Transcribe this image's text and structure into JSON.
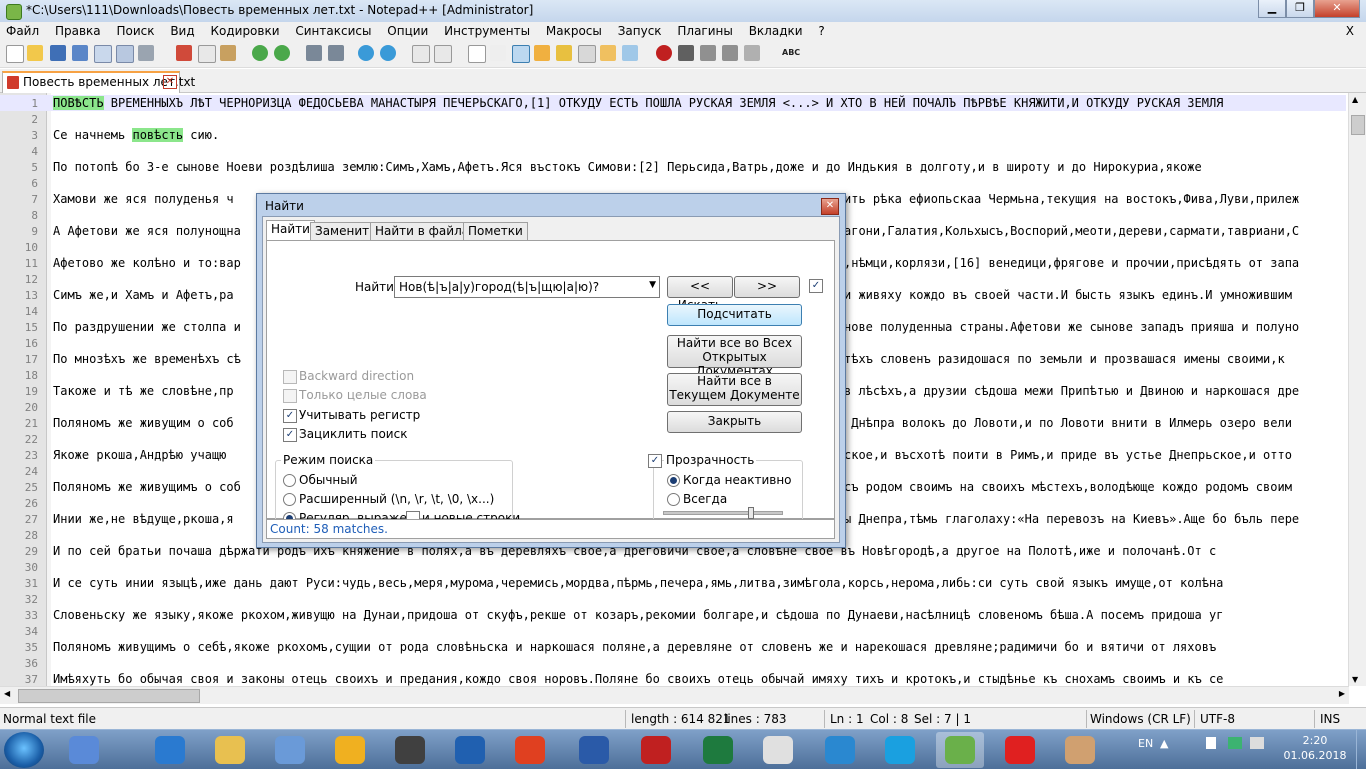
{
  "window": {
    "title": "*C:\\Users\\111\\Downloads\\Повесть временных лет.txt - Notepad++ [Administrator]",
    "minimize": "▁",
    "maximize": "❐",
    "close": "✕"
  },
  "menu": [
    "Файл",
    "Правка",
    "Поиск",
    "Вид",
    "Кодировки",
    "Синтаксисы",
    "Опции",
    "Инструменты",
    "Макросы",
    "Запуск",
    "Плагины",
    "Вкладки",
    "?"
  ],
  "menu_close": "X",
  "toolbar": {
    "icons": [
      "new-file-icon",
      "open-file-icon",
      "save-icon",
      "save-all-icon",
      "close-icon",
      "close-all-icon",
      "print-icon",
      "cut-icon",
      "copy-icon",
      "paste-icon",
      "undo-icon",
      "redo-icon",
      "find-icon",
      "replace-icon",
      "zoom-in-icon",
      "zoom-out-icon",
      "sync-vertical-icon",
      "sync-horizontal-icon",
      "word-wrap-icon",
      "show-all-chars-icon",
      "indent-guide-icon",
      "udl-icon",
      "doc-map-icon",
      "function-list-icon",
      "folder-workspace-icon",
      "monitoring-icon",
      "record-macro-icon",
      "stop-record-icon",
      "play-macro-icon",
      "play-multiple-icon",
      "save-macro-icon",
      "spell-check-icon"
    ],
    "spell_label": "ABC"
  },
  "tab": {
    "label": "Повесть временных лет.txt",
    "close": "✕"
  },
  "editor": {
    "lines": [
      {
        "n": "1",
        "pre": "",
        "hl": "ПОВѢСТЬ",
        "post": " ВРЕМЕННЫХЪ ЛѢТ ЧЕРНОРИЗЦА ФЕДОСЬЕВА МАНАСТЫРЯ ПЕЧЕРЬСКАГО,[1] ОТКУДУ ЕСТЬ ПОШЛА РУСКАЯ ЗЕМЛЯ <...> И ХТО В НЕЙ ПОЧАЛЪ ПѢРВѢЕ КНЯЖИТИ,И ОТКУДУ РУСКАЯ ЗЕМЛЯ"
      },
      {
        "n": "2",
        "pre": "",
        "hl": "",
        "post": ""
      },
      {
        "n": "3",
        "pre": "Се начнемь ",
        "hl": "повѣсть",
        "post": " сию."
      },
      {
        "n": "4",
        "pre": "",
        "hl": "",
        "post": ""
      },
      {
        "n": "5",
        "pre": "По потопѣ бо 3-е сынове Ноеви роздѣлиша землю:Симъ,Хамъ,Афетъ.Яся въстокъ Симови:[2] Перьсида,Ватрь,доже и до Индькия в долготу,и в широту и до Нирокуриа,якоже",
        "hl": "",
        "post": ""
      },
      {
        "n": "6",
        "pre": "",
        "hl": "",
        "post": ""
      },
      {
        "n": "7",
        "pre": "Хамови же яся полуденья ч",
        "hl": "",
        "post": ""
      },
      {
        "n": "8",
        "pre": "",
        "hl": "",
        "post": ""
      },
      {
        "n": "9",
        "pre": "А Афетови же яся полунощна",
        "hl": "",
        "post": ""
      },
      {
        "n": "10",
        "pre": "",
        "hl": "",
        "post": ""
      },
      {
        "n": "11",
        "pre": "Афетово же колѣно и то:вар",
        "hl": "",
        "post": ""
      },
      {
        "n": "12",
        "pre": "",
        "hl": "",
        "post": ""
      },
      {
        "n": "13",
        "pre": "Симъ же,и Хамъ и Афетъ,ра",
        "hl": "",
        "post": ""
      },
      {
        "n": "14",
        "pre": "",
        "hl": "",
        "post": ""
      },
      {
        "n": "15",
        "pre": "По раздрушении же столпа и",
        "hl": "",
        "post": ""
      },
      {
        "n": "16",
        "pre": "",
        "hl": "",
        "post": ""
      },
      {
        "n": "17",
        "pre": "По мнозѣхъ же временѣхъ сѣ",
        "hl": "",
        "post": ""
      },
      {
        "n": "18",
        "pre": "",
        "hl": "",
        "post": ""
      },
      {
        "n": "19",
        "pre": "Такоже и тѣ же словѣне,пр",
        "hl": "",
        "post": ""
      },
      {
        "n": "20",
        "pre": "",
        "hl": "",
        "post": ""
      },
      {
        "n": "21",
        "pre": "Поляномъ же живущим о соб",
        "hl": "",
        "post": ""
      },
      {
        "n": "22",
        "pre": "",
        "hl": "",
        "post": ""
      },
      {
        "n": "23",
        "pre": "Якоже ркоша,Андрѣю учащю",
        "hl": "",
        "post": ""
      },
      {
        "n": "24",
        "pre": "",
        "hl": "",
        "post": ""
      },
      {
        "n": "25",
        "pre": "Поляномъ же живущимъ о соб",
        "hl": "",
        "post": ""
      },
      {
        "n": "26",
        "pre": "",
        "hl": "",
        "post": ""
      },
      {
        "n": "27",
        "pre": "Инии же,не вѣдуще,ркоша,я",
        "hl": "",
        "post": ""
      },
      {
        "n": "28",
        "pre": "",
        "hl": "",
        "post": ""
      },
      {
        "n": "29",
        "pre": "И по сей братьи почаша дѣржати родъ ихъ княжение в полях,а въ деревляхъ свое,а дреговичи свое,а словѣне свое въ Новѣгородѣ,а другое на Полотѣ,иже и полочанѣ.От с",
        "hl": "",
        "post": ""
      },
      {
        "n": "30",
        "pre": "",
        "hl": "",
        "post": ""
      },
      {
        "n": "31",
        "pre": "И се суть инии языцѣ,иже дань дают Руси:чудь,весь,меря,мурома,черемись,мордва,пѣрмь,печера,ямь,литва,зимѣгола,корсь,нерома,либь:си суть свой языкъ имуще,от колѣна",
        "hl": "",
        "post": ""
      },
      {
        "n": "32",
        "pre": "",
        "hl": "",
        "post": ""
      },
      {
        "n": "33",
        "pre": "Словеньску же языку,якоже ркохом,живущю на Дунаи,придоша от скуфъ,рекше от козаръ,рекомии болгаре,и сѣдоша по Дунаеви,насѣлницѣ словеномъ бѣша.А посемъ придоша уг",
        "hl": "",
        "post": ""
      },
      {
        "n": "34",
        "pre": "",
        "hl": "",
        "post": ""
      },
      {
        "n": "35",
        "pre": "Поляномъ живущимъ о себѣ,якоже ркохомъ,сущии от рода словѣньска и наркошася поляне,а деревляне от словенъ же и нарекошася древляне;радимичи бо и вятичи от ляховъ",
        "hl": "",
        "post": ""
      },
      {
        "n": "36",
        "pre": "",
        "hl": "",
        "post": ""
      },
      {
        "n": "37",
        "pre": "Имѣяхуть бо обычая своя и законы отець своихъ и предания,кождо своя норовъ.Поляне бо своихъ отець обычай имяху тихъ и кротокъ,и стыдѣнье къ снохамъ своимъ и къ се",
        "hl": "",
        "post": ""
      }
    ],
    "right_text": {
      "7": "ить рѣка ефиопьскаа Чермьна,текущия на востокъ,Фива,Луви,прилеж",
      "9": "агони,Галатия,Кольхысъ,Воспорий,меоти,дереви,сармати,тавриани,С",
      "11": ",нѣмци,корлязи,[16] венедици,фрягове и прочии,присѣдять от запа",
      "13": "и живяху кождо въ своей части.И бысть языкъ единъ.И умножившим",
      "15": "нове полуденныа страны.Афетови же сынове западъ прияша и полуно",
      "17": "тѣхъ словенъ разидошася по земьли и прозвашася имены своими,к",
      "19": "в лѣсѣхъ,а друзии сѣдоша межи Припѣтью и Двиною и наркошася дре",
      "21": " Днѣпра волокъ до Ловоти,и по Ловоти внити в Илмерь озеро вели",
      "23": "ское,и въсхотѣ поити в Римъ,и приде въ устье Днепрьское,и отто",
      "25": "съ родом своимъ на своихъ мѣстехъ,володѣюще кождо родомъ своим",
      "27": "ы Днепра,тѣмь глаголаху:«На перевозъ на Киевъ».Аще бо бъль пере"
    }
  },
  "find_dialog": {
    "title": "Найти",
    "tabs": [
      "Найти",
      "Заменить",
      "Найти в файлах",
      "Пометки"
    ],
    "find_label": "Найти:",
    "find_value": "Нов(ѣ|ъ|а|у)город(ѣ|ъ|щю|а|ю)?",
    "buttons": {
      "prev": "<< Искать",
      "next": ">>",
      "count": "Подсчитать",
      "find_all_open_1": "Найти все во Всех",
      "find_all_open_2": "Открытых Документах",
      "find_all_current_1": "Найти все в",
      "find_all_current_2": "Текущем Документе",
      "close": "Закрыть"
    },
    "options": {
      "backward": {
        "label": "Backward direction",
        "checked": false,
        "enabled": false
      },
      "whole_word": {
        "label": "Только целые слова",
        "checked": false,
        "enabled": false
      },
      "match_case": {
        "label": "Учитывать регистр",
        "checked": true
      },
      "wrap": {
        "label": "Зациклить поиск",
        "checked": true
      }
    },
    "search_mode": {
      "label": "Режим поиска",
      "normal": "Обычный",
      "extended": "Расширенный (\\n, \\r, \\t, \\0, \\x...)",
      "regex": "Регуляр. выражен.",
      "selected": "regex",
      "newline": "и новые строки"
    },
    "transparency": {
      "label": "Прозрачность",
      "checked": true,
      "on_lose_focus": "Когда неактивно",
      "always": "Всегда",
      "selected": "on_lose_focus"
    },
    "status": "Count: 58 matches."
  },
  "statusbar": {
    "type": "Normal text file",
    "length": "length : 614 821",
    "lines": "lines : 783",
    "ln": "Ln : 1",
    "col": "Col : 8",
    "sel": "Sel : 7 | 1",
    "eol": "Windows (CR LF)",
    "encoding": "UTF-8",
    "mode": "INS"
  },
  "taskbar": {
    "apps": [
      "microphone-app",
      "audio-app",
      "file-explorer",
      "photos-app",
      "orange-v-app",
      "photo-editor-app",
      "ccleaner-app",
      "media-player-app",
      "word-app",
      "gpu-app",
      "excel-app",
      "chrome-app",
      "phone-sync-app",
      "skype-app",
      "notepadpp-app",
      "yandex-app",
      "paint-app"
    ],
    "lang": "EN",
    "time": "2:20",
    "date": "01.06.2018"
  }
}
